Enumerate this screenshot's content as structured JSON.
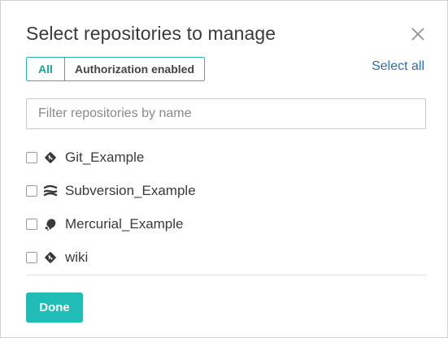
{
  "dialog": {
    "title": "Select repositories to manage"
  },
  "filters": {
    "all_label": "All",
    "auth_label": "Authorization enabled",
    "active": "All"
  },
  "select_all_label": "Select all",
  "search": {
    "placeholder": "Filter repositories by name",
    "value": ""
  },
  "repositories": [
    {
      "name": "Git_Example",
      "type": "git",
      "icon": "git-icon",
      "checked": false
    },
    {
      "name": "Subversion_Example",
      "type": "subversion",
      "icon": "subversion-icon",
      "checked": false
    },
    {
      "name": "Mercurial_Example",
      "type": "mercurial",
      "icon": "mercurial-icon",
      "checked": false
    },
    {
      "name": "wiki",
      "type": "git",
      "icon": "git-icon",
      "checked": false
    }
  ],
  "done_label": "Done",
  "colors": {
    "accent": "#1fbdb6",
    "link": "#2a6fb0",
    "toggle_border": "#26b8b0"
  }
}
